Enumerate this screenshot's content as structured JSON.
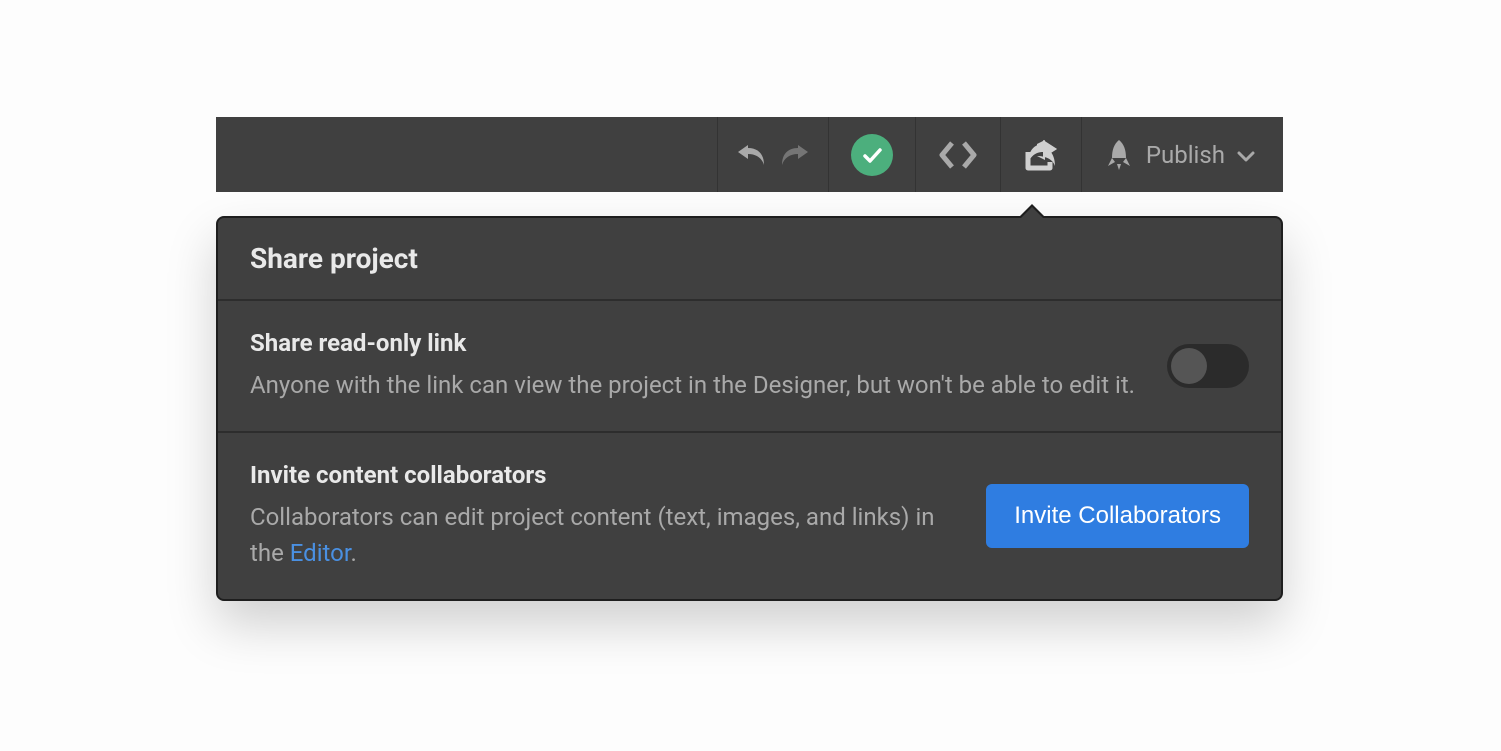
{
  "toolbar": {
    "publish_label": "Publish"
  },
  "panel": {
    "title": "Share project",
    "sections": {
      "readonly": {
        "title": "Share read-only link",
        "desc": "Anyone with the link can view the project in the Designer, but won't be able to edit it.",
        "toggle_on": false
      },
      "invite": {
        "title": "Invite content collaborators",
        "desc_before": "Collaborators can edit project content (text, images, and links) in the ",
        "desc_link": "Editor",
        "desc_after": ".",
        "button_label": "Invite Collaborators"
      }
    }
  }
}
